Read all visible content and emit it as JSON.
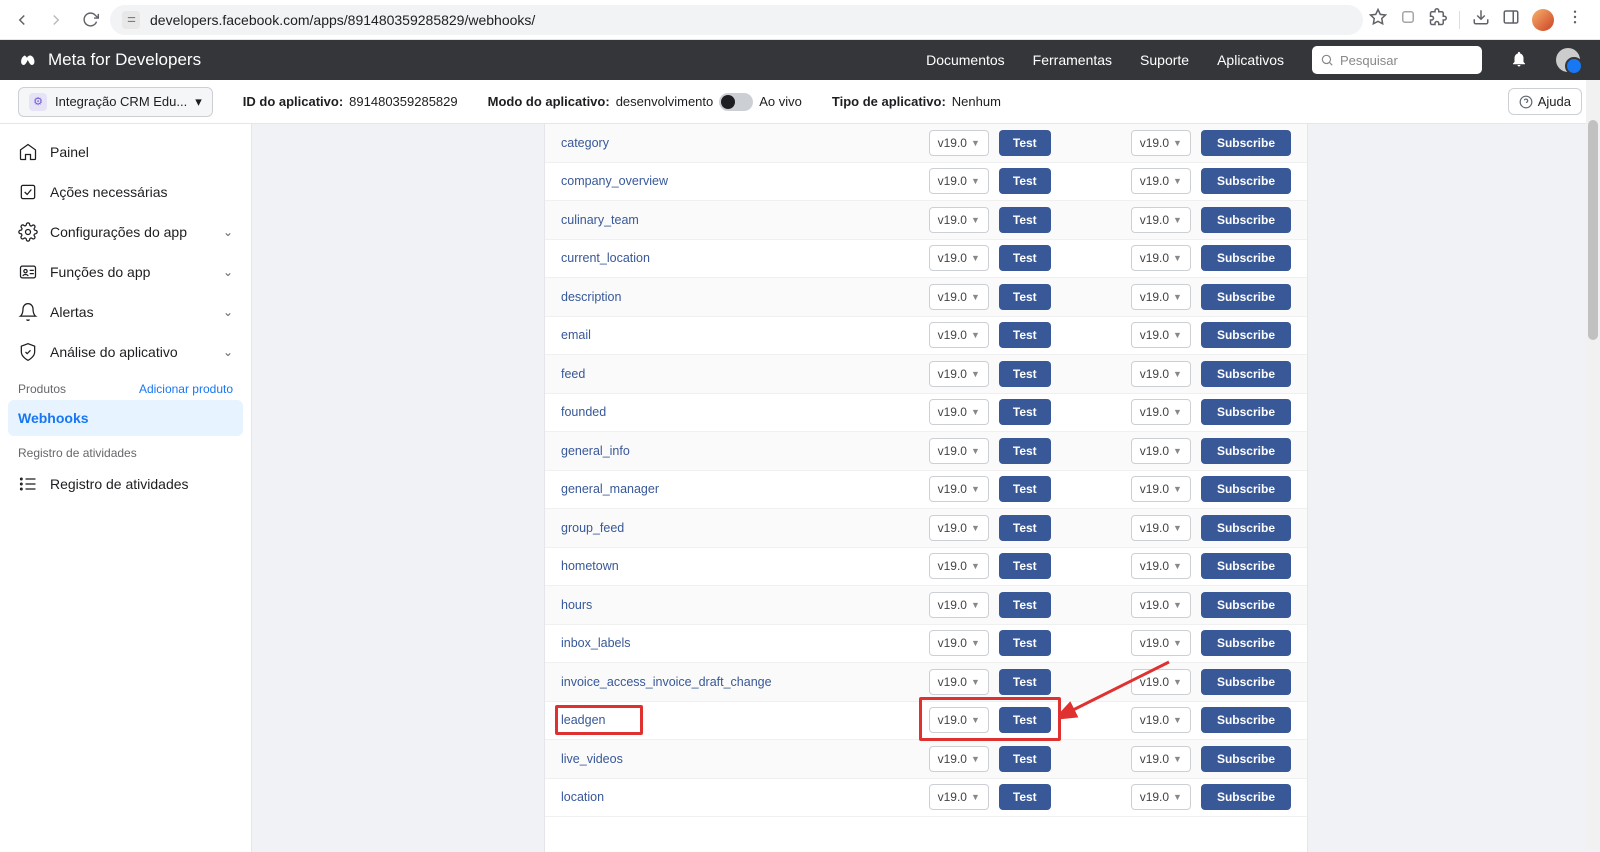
{
  "browser": {
    "url": "developers.facebook.com/apps/891480359285829/webhooks/"
  },
  "meta_header": {
    "brand": "Meta for Developers",
    "nav": {
      "docs": "Documentos",
      "tools": "Ferramentas",
      "support": "Suporte",
      "apps": "Aplicativos"
    },
    "search_placeholder": "Pesquisar"
  },
  "app_bar": {
    "app_name": "Integração CRM Edu...",
    "app_id_label": "ID do aplicativo:",
    "app_id": "891480359285829",
    "mode_label": "Modo do aplicativo:",
    "mode_value": "desenvolvimento",
    "live_label": "Ao vivo",
    "type_label": "Tipo de aplicativo:",
    "type_value": "Nenhum",
    "help": "Ajuda"
  },
  "sidebar": {
    "painel": "Painel",
    "acoes": "Ações necessárias",
    "config": "Configurações do app",
    "funcoes": "Funções do app",
    "alertas": "Alertas",
    "analise": "Análise do aplicativo",
    "produtos_label": "Produtos",
    "adicionar_produto": "Adicionar produto",
    "webhooks": "Webhooks",
    "registro_label": "Registro de atividades",
    "registro_item": "Registro de atividades"
  },
  "table": {
    "version_label": "v19.0",
    "test_label": "Test",
    "subscribe_label": "Subscribe",
    "fields": [
      "category",
      "company_overview",
      "culinary_team",
      "current_location",
      "description",
      "email",
      "feed",
      "founded",
      "general_info",
      "general_manager",
      "group_feed",
      "hometown",
      "hours",
      "inbox_labels",
      "invoice_access_invoice_draft_change",
      "leadgen",
      "live_videos",
      "location"
    ]
  },
  "annotations": {
    "highlight_field": "leadgen"
  }
}
